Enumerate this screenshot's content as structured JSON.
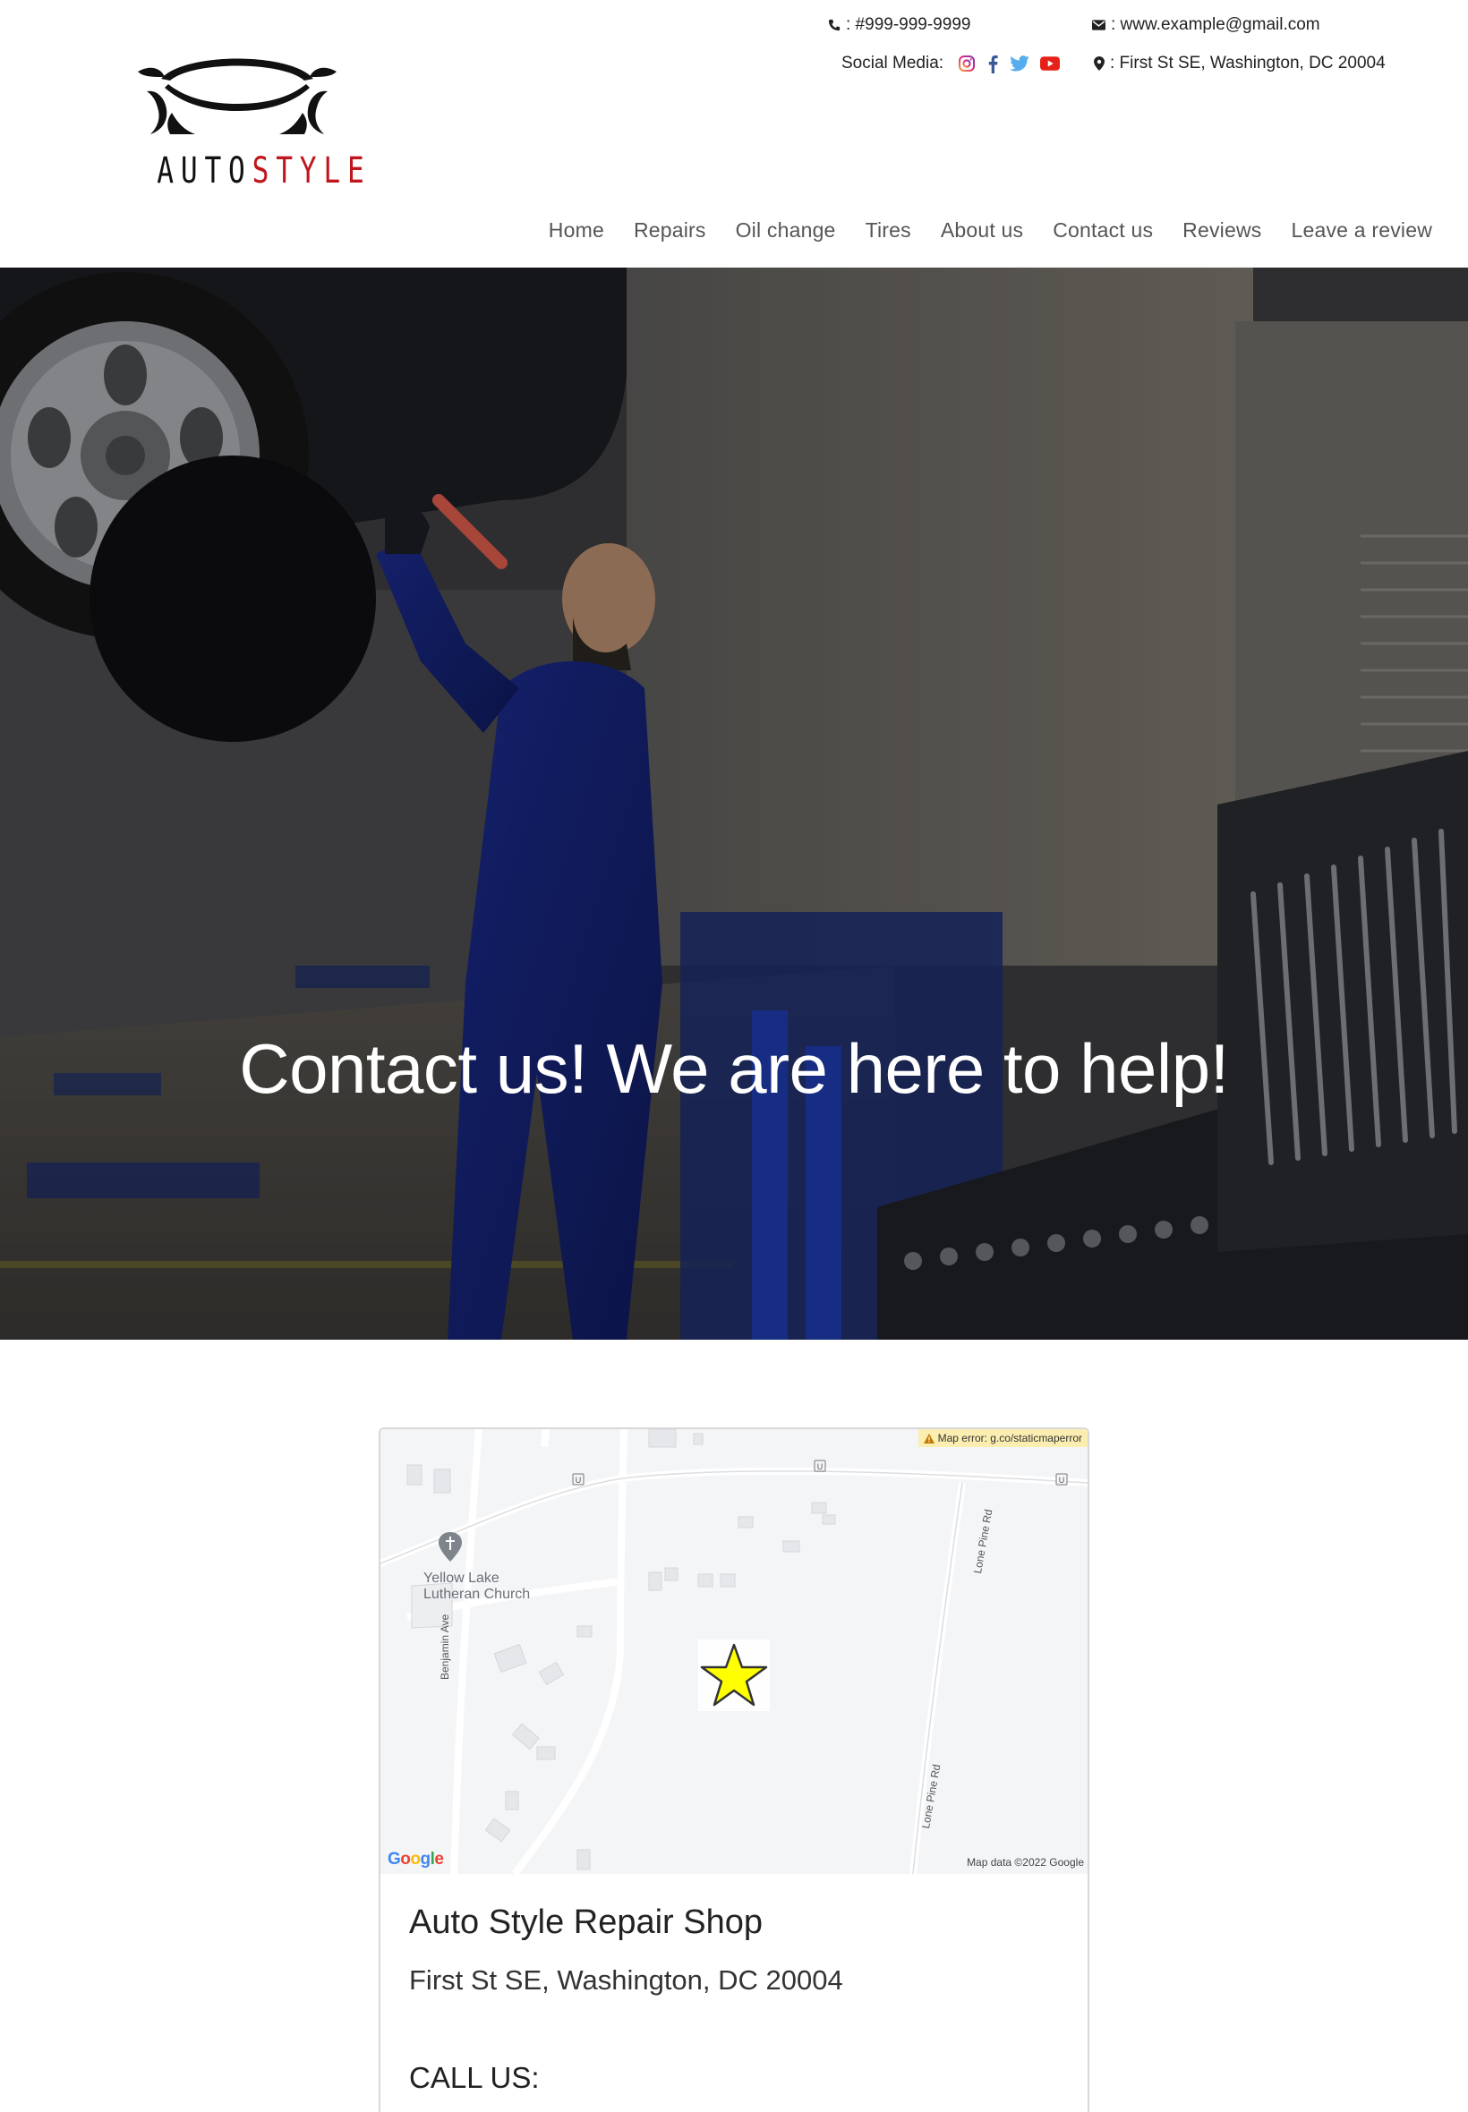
{
  "brand": {
    "word_part1": "AUTO",
    "word_part2": "STYLE",
    "accent_color": "#c0161d"
  },
  "contact": {
    "phone": ": #999-999-9999",
    "email": ": www.example@gmail.com",
    "social_label": "Social Media:",
    "address": ": First St SE, Washington, DC 20004"
  },
  "social_icons": [
    "instagram-icon",
    "facebook-icon",
    "twitter-icon",
    "youtube-icon"
  ],
  "nav": {
    "home": "Home",
    "repairs": "Repairs",
    "oil_change": "Oil change",
    "tires": "Tires",
    "about": "About us",
    "contact": "Contact us",
    "reviews": "Reviews",
    "leave_review": "Leave a review"
  },
  "hero": {
    "title": "Contact us! We are here to help!"
  },
  "map": {
    "error": "Map error: g.co/staticmaperror",
    "place": "Yellow Lake\nLutheran Church",
    "road_1": "Benjamin Ave",
    "road_2": "Lone Pine Rd",
    "road_3": "Lone Pine Rd",
    "google": "Google",
    "attribution": "Map data ©2022 Google",
    "marker_color": "#ffff00"
  },
  "card": {
    "name": "Auto Style Repair Shop",
    "address": "First St SE, Washington, DC 20004",
    "call_label": "CALL US:"
  }
}
